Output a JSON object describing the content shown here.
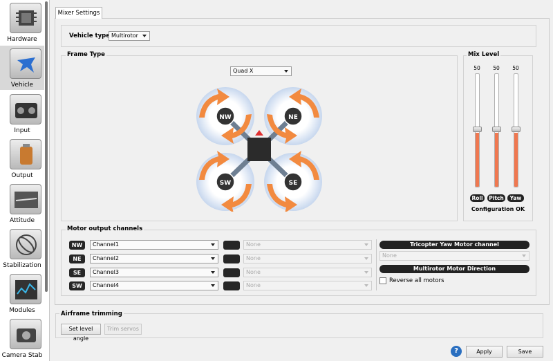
{
  "sidebar": {
    "items": [
      {
        "label": "Hardware",
        "icon": "chip-icon"
      },
      {
        "label": "Vehicle",
        "icon": "aircraft-icon"
      },
      {
        "label": "Input",
        "icon": "transmitter-icon"
      },
      {
        "label": "Output",
        "icon": "motor-icon"
      },
      {
        "label": "Attitude",
        "icon": "horizon-icon"
      },
      {
        "label": "Stabilization",
        "icon": "gyro-icon"
      },
      {
        "label": "Modules",
        "icon": "modules-icon"
      },
      {
        "label": "Camera Stab",
        "icon": "camera-icon"
      }
    ],
    "selected": "Vehicle"
  },
  "tab": {
    "label": "Mixer Settings"
  },
  "vehicle": {
    "label": "Vehicle type:",
    "value": "Multirotor"
  },
  "frame": {
    "title": "Frame Type",
    "value": "Quad X",
    "motors": [
      "NW",
      "NE",
      "SW",
      "SE"
    ]
  },
  "mix": {
    "title": "Mix Level",
    "sliders": [
      {
        "name": "Roll",
        "value": 50
      },
      {
        "name": "Pitch",
        "value": 50
      },
      {
        "name": "Yaw",
        "value": 50
      }
    ],
    "status": "Configuration OK"
  },
  "motors": {
    "title": "Motor output channels",
    "rows": [
      {
        "tag": "NW",
        "channel": "Channel1",
        "second": "None"
      },
      {
        "tag": "NE",
        "channel": "Channel2",
        "second": "None"
      },
      {
        "tag": "SE",
        "channel": "Channel3",
        "second": "None"
      },
      {
        "tag": "SW",
        "channel": "Channel4",
        "second": "None"
      }
    ],
    "tricopter_label": "Tricopter Yaw Motor channel",
    "tricopter_value": "None",
    "direction_label": "Multirotor Motor Direction",
    "reverse_label": "Reverse all motors"
  },
  "trim": {
    "title": "Airframe trimming",
    "level_button": "Set level angle",
    "servos_button": "Trim servos"
  },
  "footer": {
    "help": "?",
    "apply": "Apply",
    "save": "Save"
  },
  "colors": {
    "accent": "#f07850",
    "prop": "#f28a40",
    "prop_ring": "#c8d8ee"
  }
}
